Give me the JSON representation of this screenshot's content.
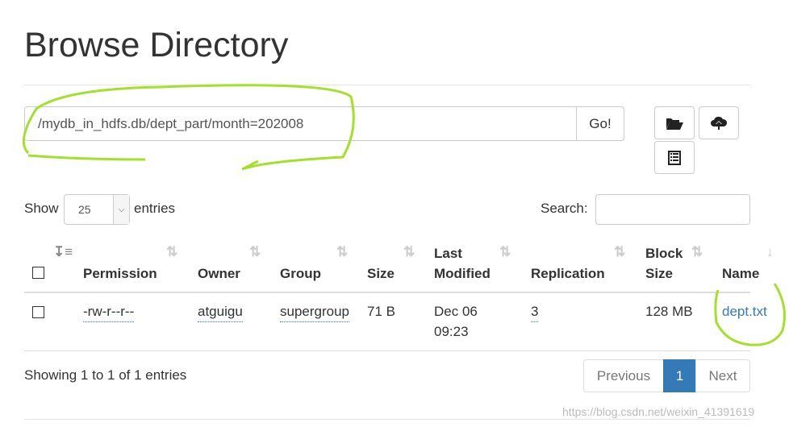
{
  "title": "Browse Directory",
  "path_value": "/mydb_in_hdfs.db/dept_part/month=202008",
  "go_label": "Go!",
  "toolbar": {
    "icons": [
      "folder-open-icon",
      "cloud-upload-icon",
      "list-icon"
    ]
  },
  "show_label": "Show",
  "entries_label": "entries",
  "page_size": "25",
  "search_label": "Search:",
  "search_value": "",
  "columns": [
    "Permission",
    "Owner",
    "Group",
    "Size",
    "Last",
    "Modified",
    "Replication",
    "Block",
    "Size",
    "Name"
  ],
  "rows": [
    {
      "permission": "-rw-r--r--",
      "owner": "atguigu",
      "group": "supergroup",
      "size": "71 B",
      "modified_date": "Dec 06",
      "modified_time": "09:23",
      "replication": "3",
      "block_size": "128 MB",
      "name": "dept.txt"
    }
  ],
  "info": "Showing 1 to 1 of 1 entries",
  "pagination": {
    "previous": "Previous",
    "current": "1",
    "next": "Next"
  },
  "watermark": "https://blog.csdn.net/weixin_41391619",
  "colors": {
    "link": "#337ab7",
    "active_page": "#337ab7",
    "annotation": "#a4e02a"
  }
}
